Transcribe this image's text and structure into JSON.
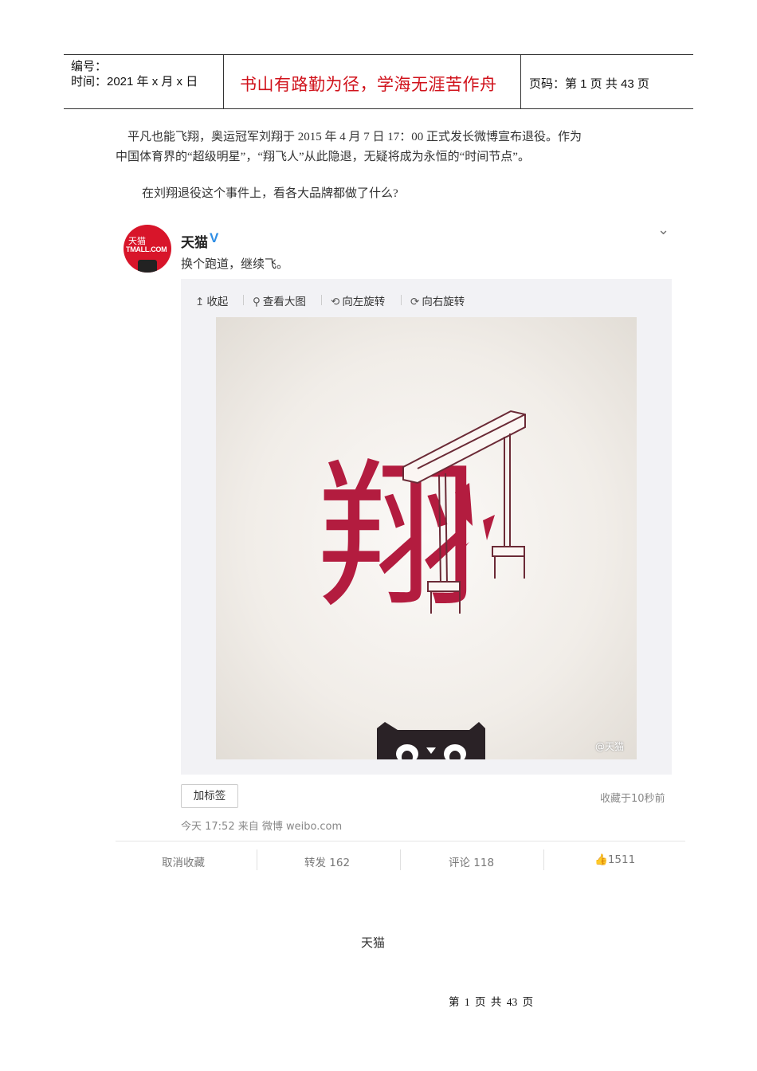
{
  "header": {
    "number_label": "编号：",
    "date_label": "时间：2021 年 x 月 x 日",
    "motto": "书山有路勤为径，学海无涯苦作舟",
    "page_info": "页码：第 1 页  共 43 页"
  },
  "body": {
    "para1_line1": "平凡也能飞翔，奥运冠军刘翔于 2015 年 4 月 7 日 17：00 正式发长微博宣布退役。作为",
    "para1_line2": "中国体育界的“超级明星”，“翔飞人”从此隐退，无疑将成为永恒的“时间节点”。",
    "para2": "在刘翔退役这个事件上，看各大品牌都做了什么?"
  },
  "weibo": {
    "avatar_text_cn": "天猫",
    "avatar_text_en": "TMALL.COM",
    "username": "天猫",
    "verified_badge": "V",
    "post_text": "换个跑道，继续飞。",
    "expand_icon": "chevron-down-icon",
    "toolbar": [
      {
        "icon": "arrow-up-icon",
        "glyph": "↥",
        "label": "收起"
      },
      {
        "icon": "search-icon",
        "glyph": "🔍",
        "label": "查看大图"
      },
      {
        "icon": "rotate-left-icon",
        "glyph": "⟲",
        "label": "向左旋转"
      },
      {
        "icon": "rotate-right-icon",
        "glyph": "⟳",
        "label": "向右旋转"
      }
    ],
    "image_char": "翔",
    "image_watermark": "@天猫",
    "tag_button": "加标签",
    "saved_time": "收藏于10秒前",
    "meta": "今天 17:52 来自 微博 weibo.com",
    "actions": {
      "unfavorite": "取消收藏",
      "repost": "转发 162",
      "comment": "评论 118",
      "like_icon": "thumbs-up-icon",
      "like_count": "1511"
    },
    "accent_color": "#b31c3f"
  },
  "caption": "天猫",
  "footer": "第 1 页 共 43 页"
}
